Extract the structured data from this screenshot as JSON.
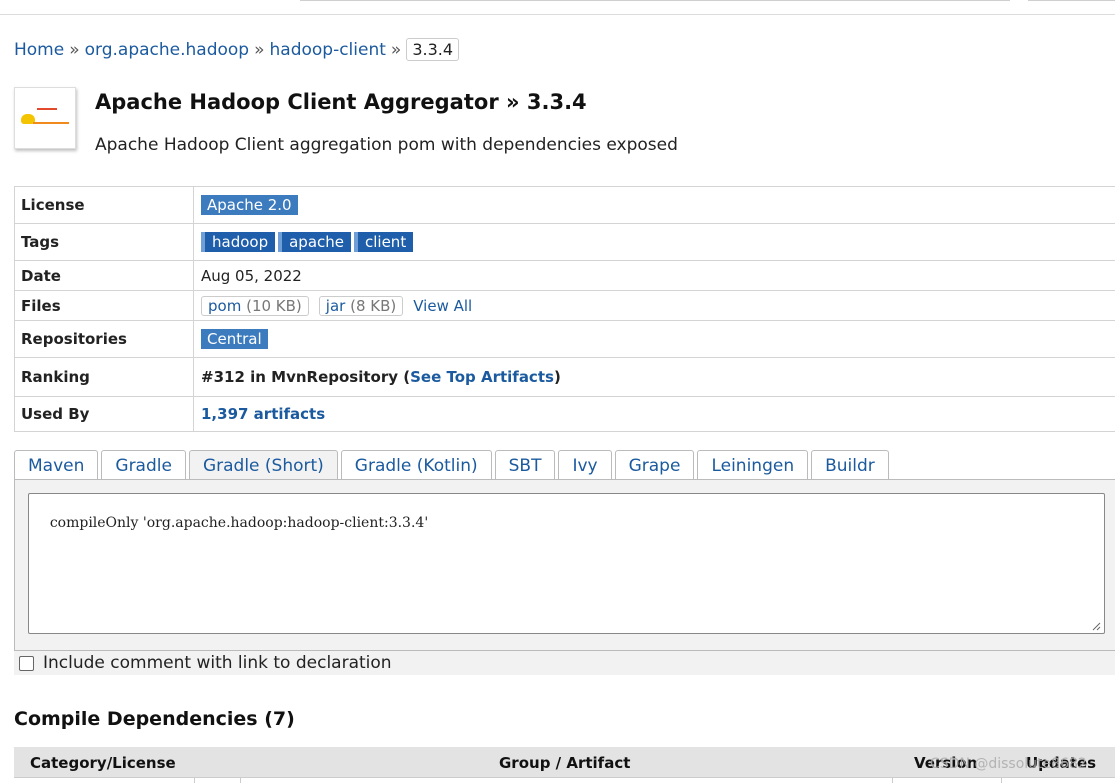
{
  "breadcrumb": {
    "items": [
      "Home",
      "org.apache.hadoop",
      "hadoop-client"
    ],
    "separator": "»",
    "current": "3.3.4"
  },
  "header": {
    "title": "Apache Hadoop Client Aggregator » 3.3.4",
    "description": "Apache Hadoop Client aggregation pom with dependencies exposed",
    "logo_icon": "hadoop-logo-icon"
  },
  "info": {
    "license": {
      "label": "License",
      "value": "Apache 2.0"
    },
    "tags": {
      "label": "Tags",
      "values": [
        "hadoop",
        "apache",
        "client"
      ]
    },
    "date": {
      "label": "Date",
      "value": "Aug 05, 2022"
    },
    "files": {
      "label": "Files",
      "items": [
        {
          "name": "pom",
          "size": "(10 KB)"
        },
        {
          "name": "jar",
          "size": "(8 KB)"
        }
      ],
      "view_all": "View All"
    },
    "repositories": {
      "label": "Repositories",
      "value": "Central"
    },
    "ranking": {
      "label": "Ranking",
      "prefix": "#312 in MvnRepository (",
      "link": "See Top Artifacts",
      "suffix": ")"
    },
    "used_by": {
      "label": "Used By",
      "value": "1,397 artifacts"
    }
  },
  "tabs": [
    "Maven",
    "Gradle",
    "Gradle (Short)",
    "Gradle (Kotlin)",
    "SBT",
    "Ivy",
    "Grape",
    "Leiningen",
    "Buildr"
  ],
  "active_tab": "Gradle (Short)",
  "code": "compileOnly 'org.apache.hadoop:hadoop-client:3.3.4'",
  "include_comment": {
    "label": "Include comment with link to declaration",
    "checked": false
  },
  "compile_deps": {
    "title": "Compile Dependencies (7)",
    "columns": [
      "Category/License",
      "Group / Artifact",
      "Version",
      "Updates"
    ]
  },
  "watermark": "CSDN @dissolute8682",
  "colors": {
    "link": "#1b5a9e",
    "badge": "#3d7bbf",
    "tag": "#1e5eaa",
    "panel": "#f2f2f2"
  }
}
